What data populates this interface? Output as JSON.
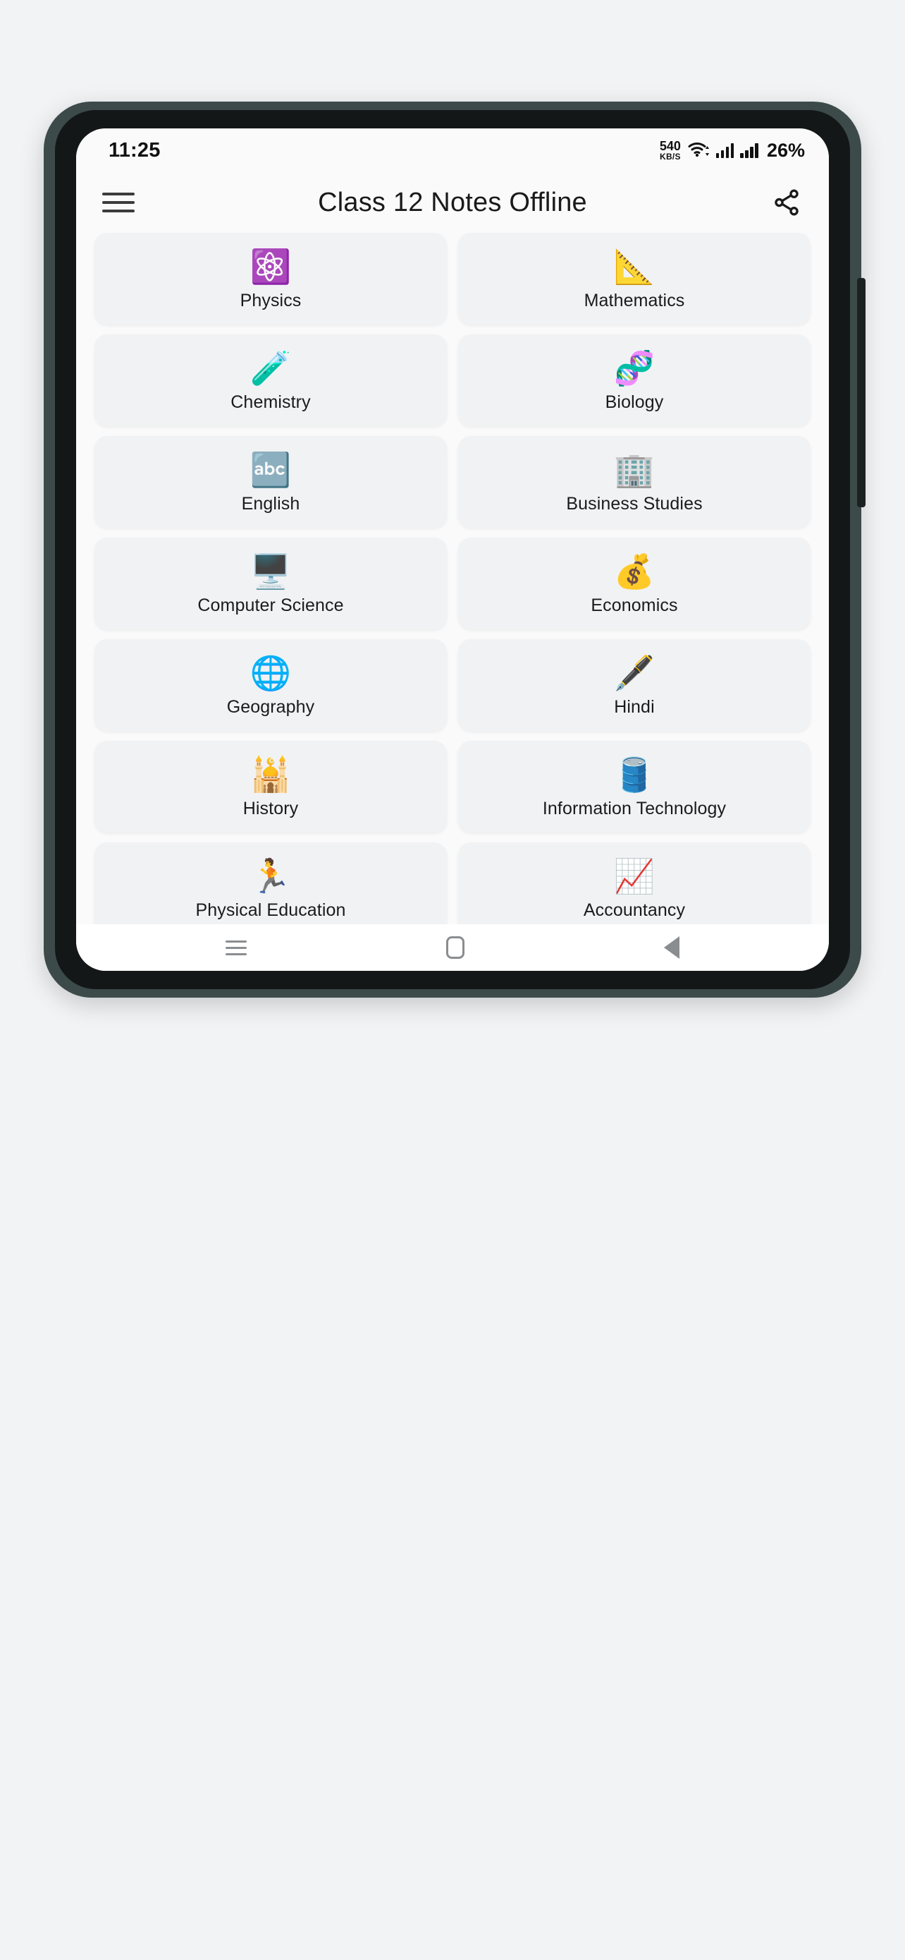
{
  "status_bar": {
    "time": "11:25",
    "net_speed_value": "540",
    "net_speed_unit": "KB/S",
    "battery": "26%",
    "icons": [
      "wifi-icon",
      "signal-icon",
      "signal-icon"
    ]
  },
  "app_bar": {
    "menu_icon": "hamburger-menu-icon",
    "title": "Class 12 Notes Offline",
    "share_icon": "share-icon"
  },
  "subjects": [
    {
      "label": "Physics",
      "icon": "⚛️",
      "icon_name": "atom-icon"
    },
    {
      "label": "Mathematics",
      "icon": "📐",
      "icon_name": "triangular-ruler-icon"
    },
    {
      "label": "Chemistry",
      "icon": "🧪",
      "icon_name": "test-tube-icon"
    },
    {
      "label": "Biology",
      "icon": "🧬",
      "icon_name": "dna-icon"
    },
    {
      "label": "English",
      "icon": "🔤",
      "icon_name": "abc-letters-icon"
    },
    {
      "label": "Business Studies",
      "icon": "🏢",
      "icon_name": "office-building-icon"
    },
    {
      "label": "Computer Science",
      "icon": "🖥️",
      "icon_name": "desktop-computer-icon"
    },
    {
      "label": "Economics",
      "icon": "💰",
      "icon_name": "gold-bars-icon"
    },
    {
      "label": "Geography",
      "icon": "🌐",
      "icon_name": "globe-icon"
    },
    {
      "label": "Hindi",
      "icon": "🖋️",
      "icon_name": "quill-ink-icon"
    },
    {
      "label": "History",
      "icon": "🕌",
      "icon_name": "monument-icon"
    },
    {
      "label": "Information Technology",
      "icon": "🛢️",
      "icon_name": "database-cylinder-icon"
    },
    {
      "label": "Physical Education",
      "icon": "🏃",
      "icon_name": "runner-icon"
    },
    {
      "label": "Accountancy",
      "icon": "📈",
      "icon_name": "chart-increasing-icon"
    },
    {
      "label": "",
      "icon": "",
      "icon_name": "partial-card-icon"
    },
    {
      "label": "",
      "icon": "",
      "icon_name": "partial-card-icon"
    }
  ],
  "nav_bar": {
    "recents": "recents-icon",
    "home": "home-icon",
    "back": "back-icon"
  },
  "colors": {
    "screen_bg": "#fafafa",
    "card_bg": "#f1f2f4",
    "page_bg": "#f2f3f5",
    "frame": "#3c4a4a",
    "bezel": "#131718",
    "nav_icon": "#8a8d90"
  }
}
